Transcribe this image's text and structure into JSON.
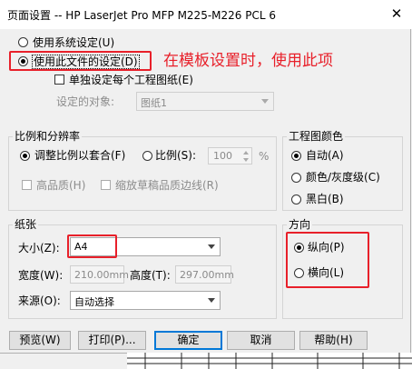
{
  "window": {
    "title": "页面设置 -- HP LaserJet Pro MFP M225-M226 PCL 6",
    "close_glyph": "✕"
  },
  "top_options": {
    "use_system": "使用系统设定(U)",
    "use_file": "使用此文件的设定(D)",
    "single_per_sheet": "单独设定每个工程图纸(E)",
    "target_label": "设定的对象:",
    "target_value": "图纸1"
  },
  "annotation": {
    "text": "在模板设置时，使用此项",
    "color": "#e8202a"
  },
  "scale": {
    "title": "比例和分辨率",
    "fit_label": "调整比例以套合(F)",
    "scale_label": "比例(S):",
    "scale_value": "100",
    "percent": "%",
    "high_quality": "高品质(H)",
    "scale_draft_edges": "缩放草稿品质边线(R)"
  },
  "color": {
    "title": "工程图颜色",
    "auto": "自动(A)",
    "color_gray": "颜色/灰度级(C)",
    "bw": "黑白(B)"
  },
  "paper": {
    "title": "纸张",
    "size_label": "大小(Z):",
    "size_value": "A4",
    "width_label": "宽度(W):",
    "width_value": "210.00mm",
    "height_label": "高度(T):",
    "height_value": "297.00mm",
    "source_label": "来源(O):",
    "source_value": "自动选择"
  },
  "orientation": {
    "title": "方向",
    "portrait": "纵向(P)",
    "landscape": "横向(L)"
  },
  "buttons": {
    "preview": "预览(W)",
    "print": "打印(P)...",
    "ok": "确定",
    "cancel": "取消",
    "help": "帮助(H)"
  }
}
